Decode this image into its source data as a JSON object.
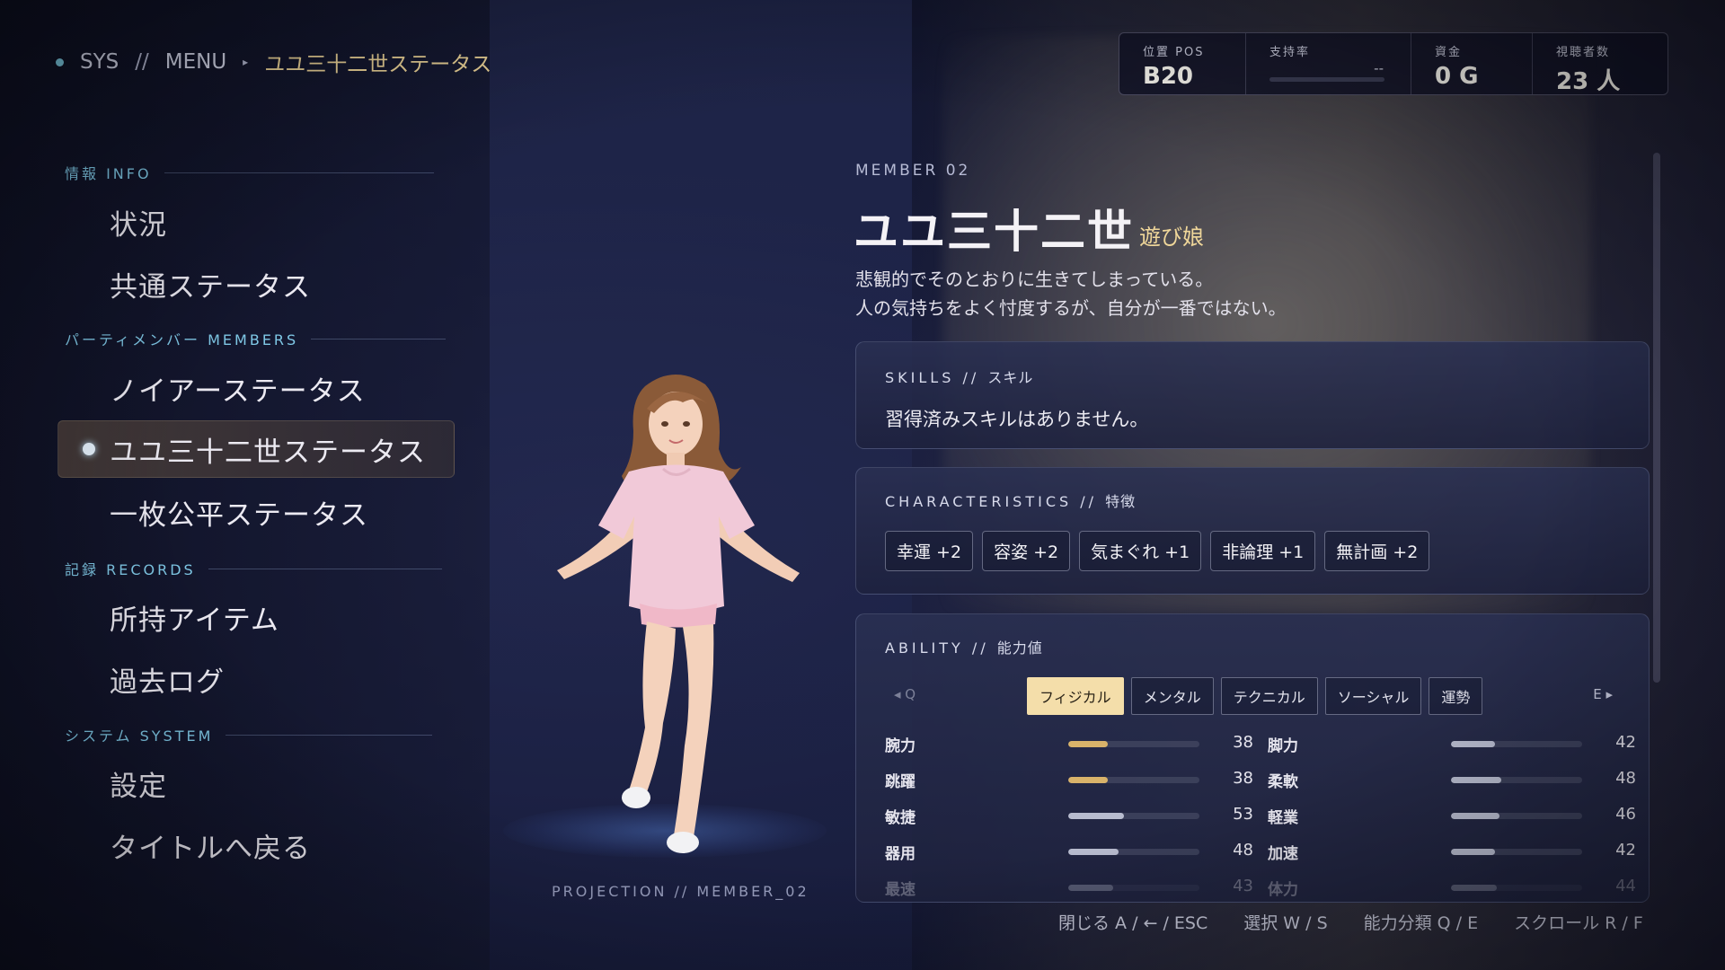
{
  "breadcrumb": {
    "sys": "SYS",
    "sep": "//",
    "menu": "MENU",
    "current": "ユユ三十二世ステータス"
  },
  "stats": {
    "position": {
      "label": "位置 POS",
      "value": "B20"
    },
    "support": {
      "label": "支持率",
      "value": "--"
    },
    "funds": {
      "label": "資金",
      "value": "0 G"
    },
    "viewers": {
      "label": "視聴者数",
      "value": "23 人"
    }
  },
  "nav": {
    "info": {
      "label": "情報 INFO",
      "items": [
        "状況",
        "共通ステータス"
      ]
    },
    "members": {
      "label": "パーティメンバー MEMBERS",
      "items": [
        "ノイアーステータス",
        "ユユ三十二世ステータス",
        "一枚公平ステータス"
      ],
      "active_index": 1
    },
    "records": {
      "label": "記録 RECORDS",
      "items": [
        "所持アイテム",
        "過去ログ"
      ]
    },
    "system": {
      "label": "システム SYSTEM",
      "items": [
        "設定",
        "タイトルへ戻る"
      ]
    }
  },
  "projection_label": "PROJECTION // MEMBER_02",
  "member": {
    "number": "MEMBER 02",
    "name": "ユユ三十二世",
    "title": "遊び娘",
    "desc1": "悲観的でそのとおりに生きてしまっている。",
    "desc2": "人の気持ちをよく忖度するが、自分が一番ではない。"
  },
  "skills": {
    "title_en": "SKILLS",
    "sep": "//",
    "title_jp": "スキル",
    "empty_text": "習得済みスキルはありません。"
  },
  "characteristics": {
    "title_en": "CHARACTERISTICS",
    "sep": "//",
    "title_jp": "特徴",
    "chips": [
      "幸運 +2",
      "容姿 +2",
      "気まぐれ +1",
      "非論理 +1",
      "無計画 +2"
    ]
  },
  "ability": {
    "title_en": "ABILITY",
    "sep": "//",
    "title_jp": "能力値",
    "hint_left": "◂ Q",
    "hint_right": "E ▸",
    "tabs": [
      "フィジカル",
      "メンタル",
      "テクニカル",
      "ソーシャル",
      "運勢"
    ],
    "active_tab": 0,
    "max": 100,
    "left": [
      {
        "label": "腕力",
        "value": 38,
        "color": "#d9b36a"
      },
      {
        "label": "跳躍",
        "value": 38,
        "color": "#d9b36a"
      },
      {
        "label": "敏捷",
        "value": 53,
        "color": "#b8bccf"
      },
      {
        "label": "器用",
        "value": 48,
        "color": "#b8bccf"
      },
      {
        "label": "最速",
        "value": 43,
        "color": "#b8bccf"
      }
    ],
    "right": [
      {
        "label": "脚力",
        "value": 42,
        "color": "#b8bccf"
      },
      {
        "label": "柔軟",
        "value": 48,
        "color": "#b8bccf"
      },
      {
        "label": "軽業",
        "value": 46,
        "color": "#b8bccf"
      },
      {
        "label": "加速",
        "value": 42,
        "color": "#b8bccf"
      },
      {
        "label": "体力",
        "value": 44,
        "color": "#b8bccf"
      }
    ]
  },
  "hints": [
    "閉じる A / ← / ESC",
    "選択 W / S",
    "能力分類 Q / E",
    "スクロール R / F"
  ]
}
